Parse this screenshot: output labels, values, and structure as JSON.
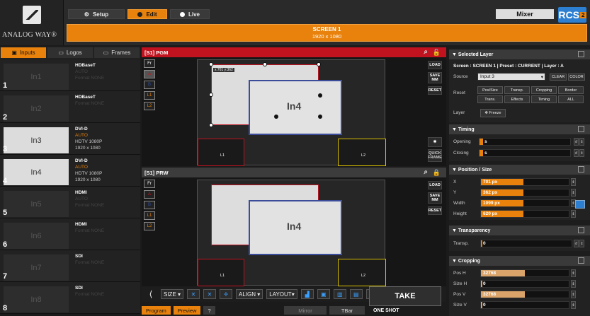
{
  "brand": {
    "logo_text": "ANALOG WAY®",
    "rcs_label": "RCS",
    "rcs_sup": "2"
  },
  "top_tabs": [
    {
      "label": "Setup"
    },
    {
      "label": "Edit"
    },
    {
      "label": "Live"
    }
  ],
  "mixer_label": "Mixer",
  "screen": {
    "title": "SCREEN 1",
    "resolution": "1920 x 1080"
  },
  "left_tabs": [
    {
      "label": "Inputs"
    },
    {
      "label": "Logos"
    },
    {
      "label": "Frames"
    }
  ],
  "inputs": [
    {
      "num": "1",
      "name": "In1",
      "type": "HDBaseT",
      "l2": "AUTO",
      "l3": "Format NONE",
      "l4": "",
      "active": false
    },
    {
      "num": "2",
      "name": "In2",
      "type": "HDBaseT",
      "l2": "",
      "l3": "Format NONE",
      "l4": "",
      "active": false
    },
    {
      "num": "3",
      "name": "In3",
      "type": "DVI-D",
      "l2": "AUTO",
      "l3": "HDTV 1080P",
      "l4": "1920 x 1080",
      "active": true
    },
    {
      "num": "4",
      "name": "In4",
      "type": "DVI-D",
      "l2": "AUTO",
      "l3": "HDTV 1080P",
      "l4": "1920 x 1080",
      "active": true
    },
    {
      "num": "5",
      "name": "In5",
      "type": "HDMI",
      "l2": "AUTO",
      "l3": "Format NONE",
      "l4": "",
      "active": false
    },
    {
      "num": "6",
      "name": "In6",
      "type": "HDMI",
      "l2": "",
      "l3": "Format NONE",
      "l4": "",
      "active": false
    },
    {
      "num": "7",
      "name": "In7",
      "type": "SDI",
      "l2": "",
      "l3": "Format NONE",
      "l4": "",
      "active": false
    },
    {
      "num": "8",
      "name": "In8",
      "type": "SDI",
      "l2": "",
      "l3": "Format NONE",
      "l4": "",
      "active": false
    }
  ],
  "pgm": {
    "title": "[S1] PGM",
    "coord": "x:701 y:362"
  },
  "prw": {
    "title": "[S1] PRW"
  },
  "layers": [
    "Fr",
    "A",
    "B",
    "L1",
    "L2"
  ],
  "preview_labels": {
    "in4": "In4",
    "l1": "L1",
    "l2": "L2"
  },
  "side_buttons": {
    "load": "LOAD",
    "save": "SAVE MM",
    "reset": "RESET",
    "quick": "QUICK FRAME"
  },
  "toolbar": {
    "size": "SIZE ▾",
    "align": "ALIGN ▾",
    "layout": "LAYOUT▾"
  },
  "bottom": {
    "program": "Program",
    "preview": "Preview",
    "help": "?",
    "mirror": "Mirror",
    "tbar": "TBar"
  },
  "take": {
    "label": "TAKE",
    "mode": "ONE SHOT"
  },
  "selected_layer": {
    "title": "Selected Layer",
    "info": "Screen : SCREEN 1  |  Preset : CURRENT  |  Layer : A",
    "source_label": "Source",
    "source_value": "Input 3",
    "clear": "CLEAR",
    "color": "COLOR",
    "reset_label": "Reset",
    "reset_buttons": [
      "Pos/Size",
      "Transp.",
      "Cropping",
      "Border",
      "Trans.",
      "Effects",
      "Timing",
      "ALL"
    ],
    "layer_label": "Layer",
    "freeze": "Freeze"
  },
  "timing": {
    "title": "Timing",
    "opening_label": "Opening",
    "opening_value": "s",
    "closing_label": "Closing",
    "closing_value": "s"
  },
  "position_size": {
    "title": "Position / Size",
    "fields": [
      {
        "label": "X",
        "value": "701 px",
        "fraction": 0.48
      },
      {
        "label": "Y",
        "value": "362 px",
        "fraction": 0.48
      },
      {
        "label": "Width",
        "value": "1099 px",
        "fraction": 0.48
      },
      {
        "label": "Height",
        "value": "620 px",
        "fraction": 0.48
      }
    ]
  },
  "transparency": {
    "title": "Transparency",
    "label": "Transp.",
    "value": "0"
  },
  "cropping": {
    "title": "Cropping",
    "fields": [
      {
        "label": "Pos H",
        "value": "32768",
        "fraction": 0.5
      },
      {
        "label": "Size H",
        "value": "0",
        "fraction": 0
      },
      {
        "label": "Pos V",
        "value": "32768",
        "fraction": 0.5
      },
      {
        "label": "Size V",
        "value": "0",
        "fraction": 0
      }
    ]
  }
}
